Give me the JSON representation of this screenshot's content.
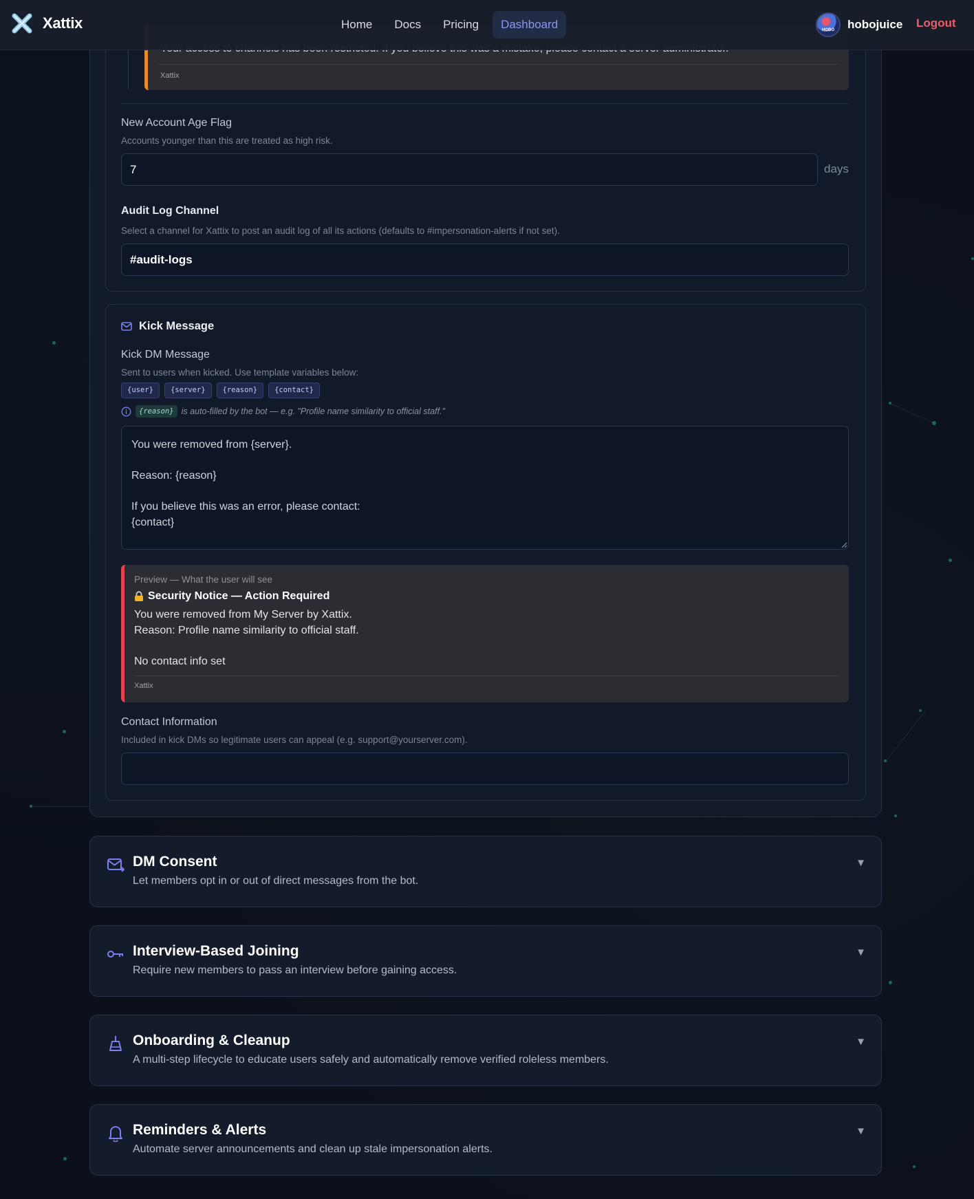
{
  "nav": {
    "brand": "Xattix",
    "links": [
      "Home",
      "Docs",
      "Pricing",
      "Dashboard"
    ],
    "active": "Dashboard",
    "username": "hobojuice",
    "avatar_text": "HOBO",
    "logout": "Logout"
  },
  "prev_embed": {
    "text": "Your access to channels has been restricted. If you believe this was a mistake, please contact a server administrator.",
    "footer": "Xattix",
    "accent": "#e88a2f"
  },
  "account_age": {
    "label": "New Account Age Flag",
    "help": "Accounts younger than this are treated as high risk.",
    "value": "7",
    "suffix": "days"
  },
  "audit_log": {
    "label": "Audit Log Channel",
    "help": "Select a channel for Xattix to post an audit log of all its actions (defaults to #impersonation-alerts if not set).",
    "value": "#audit-logs"
  },
  "kick": {
    "title": "Kick Message",
    "dm_label": "Kick DM Message",
    "dm_help": "Sent to users when kicked. Use template variables below:",
    "variables": [
      "{user}",
      "{server}",
      "{reason}",
      "{contact}"
    ],
    "note_code": "{reason}",
    "note_text": "is auto-filled by the bot — e.g. \"Profile name similarity to official staff.\"",
    "message": "You were removed from {server}.\n\nReason: {reason}\n\nIf you believe this was an error, please contact:\n{contact}",
    "preview": {
      "caption": "Preview — What the user will see",
      "title": "Security Notice — Action Required",
      "body": "You were removed from My Server by Xattix.\nReason: Profile name similarity to official staff.\n\nNo contact info set",
      "footer": "Xattix",
      "accent": "#e2434e"
    },
    "contact_label": "Contact Information",
    "contact_help": "Included in kick DMs so legitimate users can appeal (e.g. support@yourserver.com).",
    "contact_value": ""
  },
  "sections": [
    {
      "title": "DM Consent",
      "desc": "Let members opt in or out of direct messages from the bot.",
      "icon": "mail-icon"
    },
    {
      "title": "Interview-Based Joining",
      "desc": "Require new members to pass an interview before gaining access.",
      "icon": "key-icon"
    },
    {
      "title": "Onboarding & Cleanup",
      "desc": "A multi-step lifecycle to educate users safely and automatically remove verified roleless members.",
      "icon": "broom-icon"
    },
    {
      "title": "Reminders & Alerts",
      "desc": "Automate server announcements and clean up stale impersonation alerts.",
      "icon": "bell-icon"
    }
  ],
  "colors": {
    "accent": "#7b7ff0",
    "logout": "#ef5d6b",
    "background": "#0b101b"
  }
}
